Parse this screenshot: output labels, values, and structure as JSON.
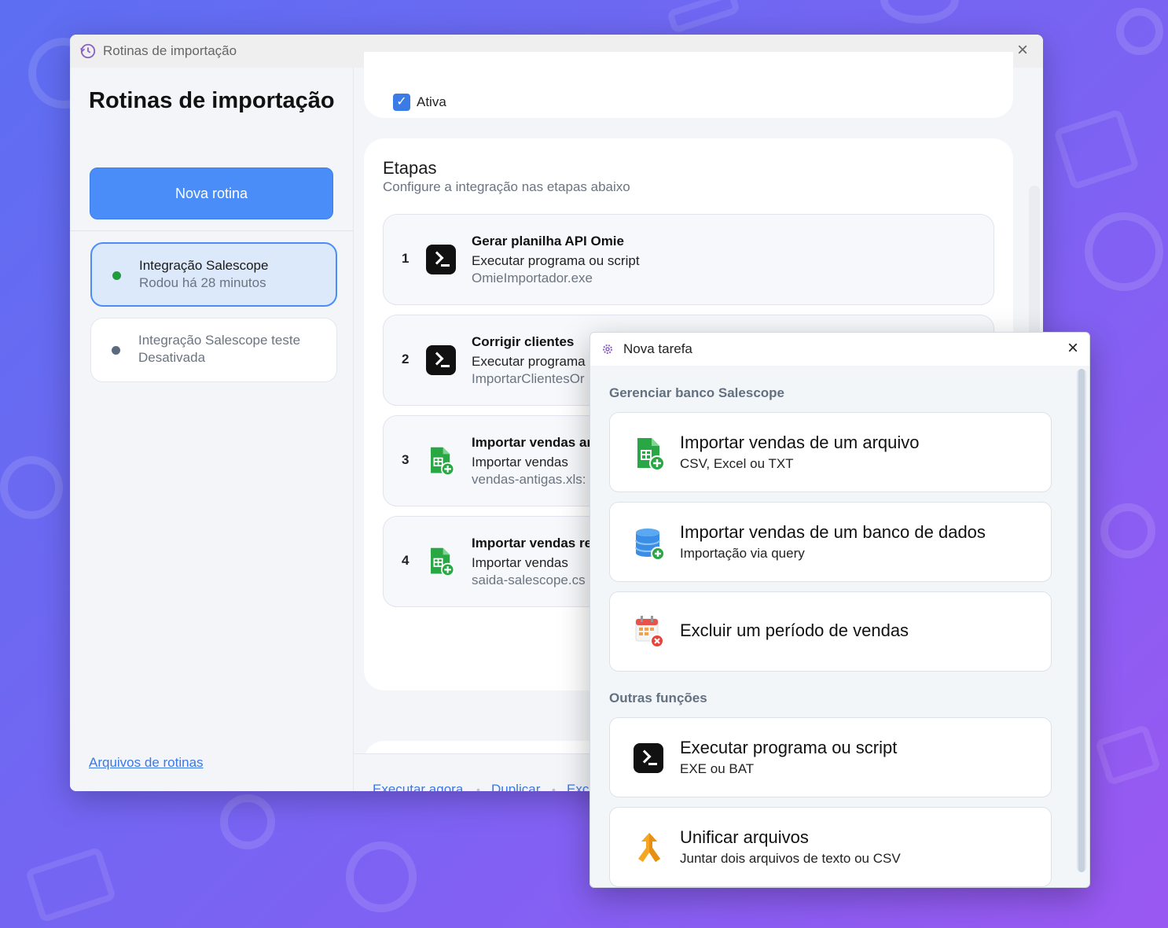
{
  "main_window": {
    "title": "Rotinas de importação",
    "sidebar": {
      "heading": "Rotinas de importação",
      "new_button": "Nova rotina",
      "routines": [
        {
          "name": "Integração Salescope",
          "status": "Rodou há 28 minutos",
          "active": true,
          "dot_color": "#1f9d3a"
        },
        {
          "name": "Integração Salescope teste",
          "status": "Desativada",
          "active": false,
          "dot_color": "#5a6a7f"
        }
      ],
      "files_link": "Arquivos de rotinas"
    },
    "checkbox_label": "Ativa",
    "etapas": {
      "title": "Etapas",
      "description": "Configure a integração nas etapas abaixo",
      "steps": [
        {
          "number": "1",
          "title": "Gerar planilha API Omie",
          "type": "Executar programa ou script",
          "file": "OmieImportador.exe",
          "icon": "terminal-icon"
        },
        {
          "number": "2",
          "title": "Corrigir clientes",
          "type": "Executar programa",
          "file": "ImportarClientesOr",
          "icon": "terminal-icon"
        },
        {
          "number": "3",
          "title": "Importar vendas ar",
          "type": "Importar vendas",
          "file": "vendas-antigas.xls:",
          "icon": "spreadsheet-add-icon"
        },
        {
          "number": "4",
          "title": "Importar vendas re",
          "type": "Importar vendas",
          "file": "saida-salescope.cs",
          "icon": "spreadsheet-add-icon"
        }
      ]
    },
    "bottom_actions": [
      "Executar agora",
      "Duplicar",
      "Exc"
    ]
  },
  "dialog": {
    "title": "Nova tarefa",
    "sections": [
      {
        "label": "Gerenciar banco Salescope",
        "options": [
          {
            "title": "Importar vendas de um arquivo",
            "subtitle": "CSV, Excel ou TXT",
            "icon": "spreadsheet-add-icon"
          },
          {
            "title": "Importar vendas de um banco de dados",
            "subtitle": "Importação via query",
            "icon": "database-add-icon"
          },
          {
            "title": "Excluir um período de vendas",
            "subtitle": "",
            "icon": "calendar-delete-icon"
          }
        ]
      },
      {
        "label": "Outras funções",
        "options": [
          {
            "title": "Executar programa ou script",
            "subtitle": "EXE ou BAT",
            "icon": "terminal-icon"
          },
          {
            "title": "Unificar arquivos",
            "subtitle": "Juntar dois arquivos de texto ou CSV",
            "icon": "merge-icon"
          }
        ]
      }
    ]
  },
  "colors": {
    "accent": "#4a8df8",
    "link": "#3b78e6",
    "background_gradient_start": "#5d6ef2",
    "background_gradient_end": "#9a58f2"
  }
}
